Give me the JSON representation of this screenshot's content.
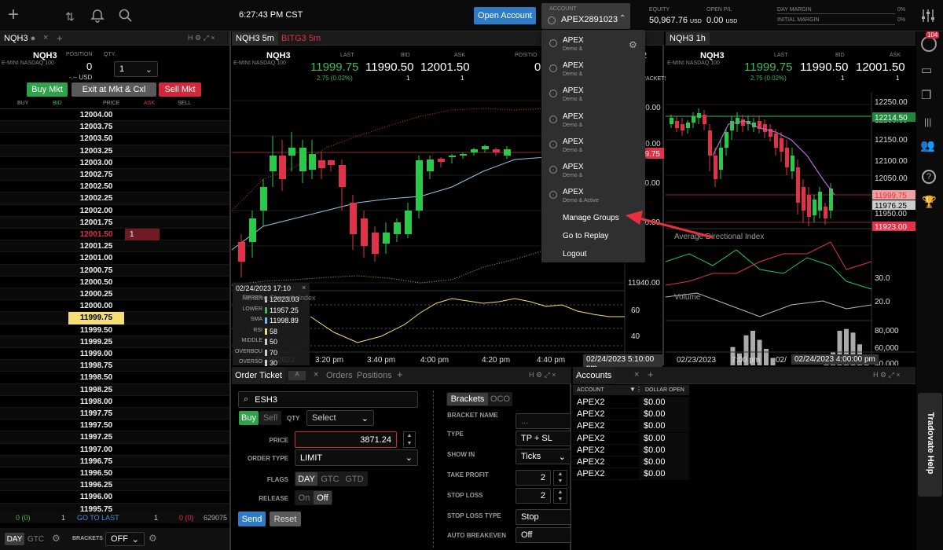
{
  "top": {
    "time": "6:27:43 PM CST",
    "open_account_label": "Open Account",
    "account_label": "ACCOUNT",
    "account_value": "APEX2891023",
    "equity_label": "EQUITY",
    "equity_value": "50,967.76",
    "equity_unit": "USD",
    "open_pl_label": "OPEN P/L",
    "open_pl_value": "0.00",
    "open_pl_unit": "USD",
    "day_margin_label": "DAY MARGIN",
    "day_margin_value": "0%",
    "initial_margin_label": "INITIAL MARGIN",
    "initial_margin_value": "0%"
  },
  "dom": {
    "tab_label": "NQH3",
    "symbol": "NQH3",
    "description": "E-MINI NASDAQ 100",
    "position_label": "POSITION",
    "position_value": "0",
    "position_sub": "-.-- USD",
    "qty_label": "QTY.",
    "qty_value": "1",
    "buy_mkt": "Buy Mkt",
    "exit_mkt": "Exit at Mkt & Cxl",
    "sell_mkt": "Sell Mkt",
    "col_buy": "BUY",
    "col_bid": "BID",
    "col_price": "PRICE",
    "col_ask": "ASK",
    "col_sell": "SELL",
    "prices": [
      "12004.00",
      "12003.75",
      "12003.50",
      "12003.25",
      "12003.00",
      "12002.75",
      "12002.50",
      "12002.25",
      "12002.00",
      "12001.75",
      "12001.50",
      "12001.25",
      "12001.00",
      "12000.75",
      "12000.50",
      "12000.25",
      "12000.00",
      "11999.75",
      "11999.50",
      "11999.25",
      "11999.00",
      "11998.75",
      "11998.50",
      "11998.25",
      "11998.00",
      "11997.75",
      "11997.50",
      "11997.25",
      "11997.00",
      "11996.75",
      "11996.50",
      "11996.25",
      "11996.00",
      "11995.75"
    ],
    "ask_qty_at_12001_50": "1",
    "footer_buy": "0 (0)",
    "footer_bid": "1",
    "footer_goto": "GO TO LAST",
    "footer_ask": "1",
    "footer_sell": "0 (0)",
    "footer_vol": "629075",
    "day": "DAY",
    "gtc": "GTC",
    "brackets_label": "BRACKETS",
    "brackets_value": "OFF"
  },
  "chart_mid": {
    "tab1": "NQH3 5m",
    "tab2": "BITG3 5m",
    "symbol": "NQH3",
    "description": "E-MINI NASDAQ 100",
    "last_label": "LAST",
    "last_value": "11999.75",
    "last_change": "2.75 (0.02%)",
    "bid_label": "BID",
    "bid_value": "11990.50",
    "bid_size": "1",
    "ask_label": "ASK",
    "ask_value": "12001.50",
    "ask_size": "1",
    "position_label": "POSITIO",
    "position_value": "0",
    "brackets_partial": "RACKETS",
    "qty_partial": "2",
    "y_labels": [
      "12020.00",
      "12000.00",
      "11980.00",
      "11960.00",
      "11940.00"
    ],
    "price_tag": "11999.75",
    "rsi_title": "Relative Strength Index",
    "rsi_labels": [
      "60",
      "40"
    ],
    "x_labels": [
      "02/24/2023",
      "3:20 pm",
      "3:40 pm",
      "4:00 pm",
      "4:20 pm",
      "4:40 pm"
    ],
    "crosshair_time": "02/24/2023 5:10:00 pm",
    "tooltip": {
      "date": "02/24/2023 17:10",
      "rows": [
        {
          "k": "UPPER",
          "v": "12023.03"
        },
        {
          "k": "LOWER",
          "v": "11957.25"
        },
        {
          "k": "SMA",
          "v": "11998.89"
        },
        {
          "k": "RSI",
          "v": "58"
        },
        {
          "k": "MIDDLE",
          "v": "50"
        },
        {
          "k": "OVERBOU",
          "v": "70"
        },
        {
          "k": "OVERSO",
          "v": "30"
        }
      ]
    }
  },
  "account_menu": {
    "accounts": [
      {
        "name": "APEX",
        "sub": "Demo &"
      },
      {
        "name": "APEX",
        "sub": "Demo &"
      },
      {
        "name": "APEX",
        "sub": "Demo &"
      },
      {
        "name": "APEX",
        "sub": "Demo &"
      },
      {
        "name": "APEX",
        "sub": "Demo &"
      },
      {
        "name": "APEX",
        "sub": "Demo &"
      },
      {
        "name": "APEX",
        "sub": "Demo & Active"
      }
    ],
    "manage_groups": "Manage Groups",
    "go_to_replay": "Go to Replay",
    "logout": "Logout"
  },
  "chart_right": {
    "tab": "NQH3 1h",
    "symbol": "NQH3",
    "description": "E-MINI NASDAQ 100",
    "last_label": "LAST",
    "last_value": "11999.75",
    "last_change": "2.75 (0.02%)",
    "bid_label": "BID",
    "bid_value": "11990.50",
    "bid_size": "1",
    "ask_label": "ASK",
    "ask_value": "12001.50",
    "ask_size": "1",
    "y_labels": [
      "12250.00",
      "12200.00",
      "12150.00",
      "12100.00",
      "12050.00",
      "11950.00"
    ],
    "tag_green": "12214.50",
    "tag_last": "11999.75",
    "tag_gray": "11976.25",
    "tag_red": "11923.00",
    "adx_title": "Average Directional Index",
    "adx_labels": [
      "30.0",
      "20.0"
    ],
    "volume_title": "Volume",
    "volume_labels": [
      "80,000",
      "60,000",
      "40,000",
      "20,000"
    ],
    "x_labels": [
      "02/23/2023",
      "7:00 pm",
      "02/"
    ],
    "crosshair_time": "02/24/2023 4:00:00 pm"
  },
  "order_ticket": {
    "title": "Order Ticket",
    "tab_orders": "Orders",
    "tab_positions": "Positions",
    "symbol": "ESH3",
    "buy": "Buy",
    "sell": "Sell",
    "qty_label": "QTY",
    "qty_placeholder": "Select",
    "price_label": "PRICE",
    "price_value": "3871.24",
    "order_type_label": "ORDER TYPE",
    "order_type_value": "LIMIT",
    "flags_label": "FLAGS",
    "flag_day": "DAY",
    "flag_gtc": "GTC",
    "flag_gtd": "GTD",
    "release_label": "RELEASE",
    "release_on": "On",
    "release_off": "Off",
    "send": "Send",
    "reset": "Reset",
    "brackets_tab": "Brackets",
    "oco_tab": "OCO",
    "bracket_name_label": "BRACKET NAME",
    "bracket_name_value": "...",
    "type_label": "TYPE",
    "type_value": "TP + SL",
    "show_in_label": "SHOW IN",
    "show_in_value": "Ticks",
    "take_profit_label": "TAKE PROFIT",
    "take_profit_value": "2",
    "stop_loss_label": "STOP LOSS",
    "stop_loss_value": "2",
    "stop_loss_type_label": "STOP LOSS TYPE",
    "stop_loss_type_value": "Stop",
    "auto_breakeven_label": "AUTO BREAKEVEN",
    "auto_breakeven_value": "Off"
  },
  "accounts_panel": {
    "title": "Accounts",
    "col_account": "ACCOUNT",
    "col_dollar_open": "DOLLAR OPEN",
    "rows": [
      {
        "account": "APEX2",
        "value": "$0.00"
      },
      {
        "account": "APEX2",
        "value": "$0.00"
      },
      {
        "account": "APEX2",
        "value": "$0.00"
      },
      {
        "account": "APEX2",
        "value": "$0.00"
      },
      {
        "account": "APEX2",
        "value": "$0.00"
      },
      {
        "account": "APEX2",
        "value": "$0.00"
      },
      {
        "account": "APEX2",
        "value": "$0.00"
      }
    ]
  },
  "sidebar": {
    "badge": "104",
    "help_label": "Tradovate Help"
  }
}
